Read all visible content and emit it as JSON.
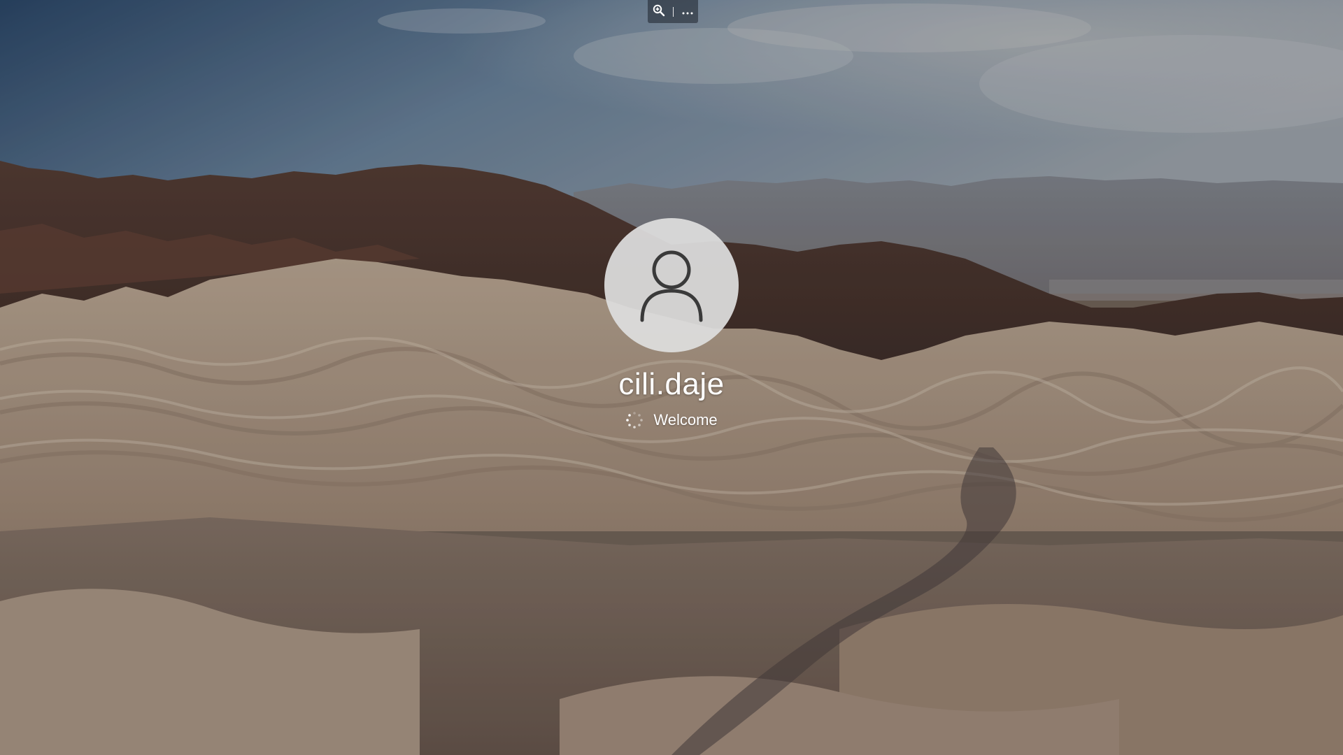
{
  "user": {
    "name": "cili.daje"
  },
  "status": {
    "message": "Welcome"
  },
  "toolbar": {
    "zoom_icon": "zoom-in-icon",
    "more_icon": "more-options-icon"
  },
  "colors": {
    "sky_top": "#2f4c6e",
    "sky_bottom": "#9aa7b3",
    "text": "#ffffff",
    "avatar_bg": "#dedede",
    "avatar_glyph": "#3a3a3a"
  }
}
